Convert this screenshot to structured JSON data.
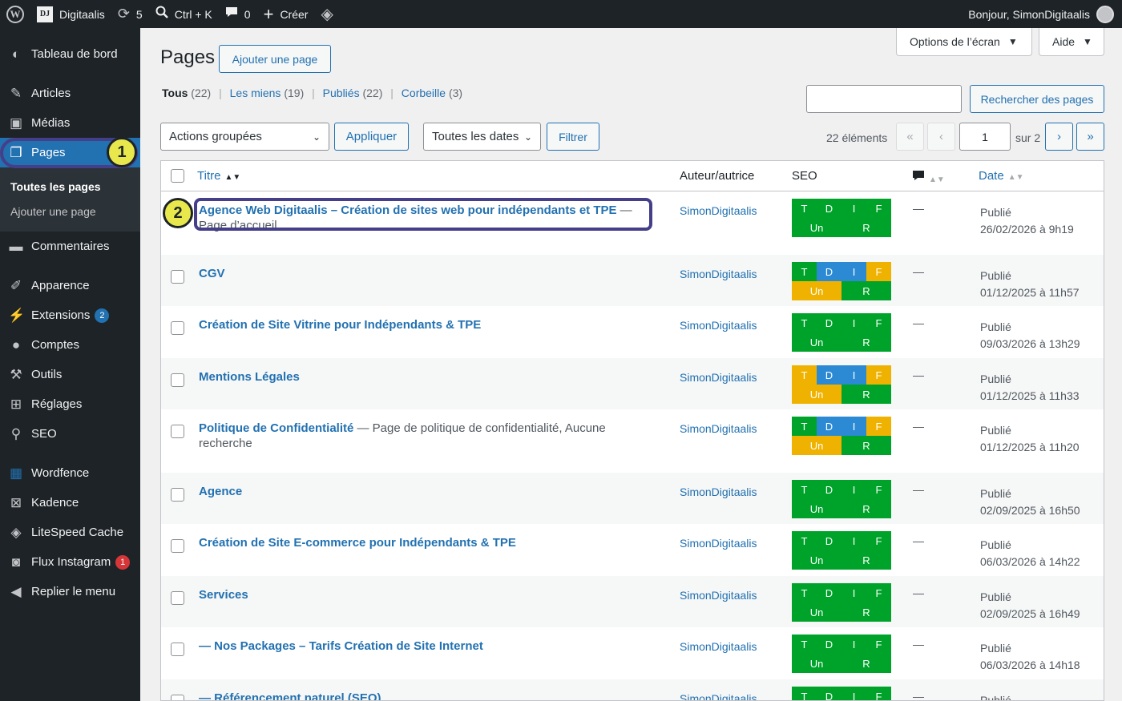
{
  "adminbar": {
    "site_name": "Digitaalis",
    "site_icon_text": "DJ",
    "updates_count": "5",
    "search_shortcut": "Ctrl + K",
    "comments_count": "0",
    "new_label": "Créer",
    "greeting": "Bonjour, SimonDigitaalis"
  },
  "sidebar": {
    "dashboard": "Tableau de bord",
    "posts": "Articles",
    "media": "Médias",
    "pages": "Pages",
    "pages_sub": [
      "Toutes les pages",
      "Ajouter une page"
    ],
    "comments": "Commentaires",
    "appearance": "Apparence",
    "plugins": "Extensions",
    "plugins_badge": "2",
    "users": "Comptes",
    "tools": "Outils",
    "settings": "Réglages",
    "seo": "SEO",
    "wordfence": "Wordfence",
    "kadence": "Kadence",
    "litespeed": "LiteSpeed Cache",
    "instagram": "Flux Instagram",
    "instagram_badge": "1",
    "collapse": "Replier le menu"
  },
  "markers": {
    "one": "1",
    "two": "2"
  },
  "header": {
    "screen_options": "Options de l’écran",
    "help": "Aide",
    "title": "Pages",
    "add_new": "Ajouter une page"
  },
  "views": {
    "all_label": "Tous",
    "all_count": "(22)",
    "mine_label": "Les miens",
    "mine_count": "(19)",
    "published_label": "Publiés",
    "published_count": "(22)",
    "trash_label": "Corbeille",
    "trash_count": "(3)"
  },
  "search": {
    "button": "Rechercher des pages",
    "value": ""
  },
  "bulk": {
    "actions": "Actions groupées",
    "apply": "Appliquer",
    "dates": "Toutes les dates",
    "filter": "Filtrer"
  },
  "pagination": {
    "items": "22 éléments",
    "first": "«",
    "prev": "‹",
    "current": "1",
    "of": "sur 2",
    "next": "›",
    "last": "»"
  },
  "table": {
    "columns": {
      "title": "Titre",
      "author": "Auteur/autrice",
      "seo": "SEO",
      "date": "Date"
    },
    "seo_labels": [
      "T",
      "D",
      "I",
      "F",
      "Un",
      "R"
    ],
    "rows": [
      {
        "title": "Agence Web Digitaalis – Création de sites web pour indépendants et TPE",
        "state": " — Page d’accueil",
        "author": "SimonDigitaalis",
        "comments": "—",
        "status": "Publié",
        "date": "26/02/2026 à 9h19",
        "seo": [
          "green",
          "green",
          "green",
          "green",
          "green",
          "green"
        ]
      },
      {
        "title": "CGV",
        "state": "",
        "author": "SimonDigitaalis",
        "comments": "—",
        "status": "Publié",
        "date": "01/12/2025 à 11h57",
        "seo": [
          "green",
          "blue",
          "blue",
          "orange",
          "orange",
          "green"
        ]
      },
      {
        "title": "Création de Site Vitrine pour Indépendants & TPE",
        "state": "",
        "author": "SimonDigitaalis",
        "comments": "—",
        "status": "Publié",
        "date": "09/03/2026 à 13h29",
        "seo": [
          "green",
          "green",
          "green",
          "green",
          "green",
          "green"
        ]
      },
      {
        "title": "Mentions Légales",
        "state": "",
        "author": "SimonDigitaalis",
        "comments": "—",
        "status": "Publié",
        "date": "01/12/2025 à 11h33",
        "seo": [
          "orange",
          "blue",
          "blue",
          "orange",
          "orange",
          "green"
        ]
      },
      {
        "title": "Politique de Confidentialité",
        "state": " — Page de politique de confidentialité, Aucune recherche",
        "author": "SimonDigitaalis",
        "comments": "—",
        "status": "Publié",
        "date": "01/12/2025 à 11h20",
        "seo": [
          "green",
          "blue",
          "blue",
          "orange",
          "orange",
          "green"
        ]
      },
      {
        "title": "Agence",
        "state": "",
        "author": "SimonDigitaalis",
        "comments": "—",
        "status": "Publié",
        "date": "02/09/2025 à 16h50",
        "seo": [
          "green",
          "green",
          "green",
          "green",
          "green",
          "green"
        ]
      },
      {
        "title": "Création de Site E-commerce pour Indépendants & TPE",
        "state": "",
        "author": "SimonDigitaalis",
        "comments": "—",
        "status": "Publié",
        "date": "06/03/2026 à 14h22",
        "seo": [
          "green",
          "green",
          "green",
          "green",
          "green",
          "green"
        ]
      },
      {
        "title": "Services",
        "state": "",
        "author": "SimonDigitaalis",
        "comments": "—",
        "status": "Publié",
        "date": "02/09/2025 à 16h49",
        "seo": [
          "green",
          "green",
          "green",
          "green",
          "green",
          "green"
        ]
      },
      {
        "title": "— Nos Packages – Tarifs Création de Site Internet",
        "state": "",
        "author": "SimonDigitaalis",
        "comments": "—",
        "status": "Publié",
        "date": "06/03/2026 à 14h18",
        "seo": [
          "green",
          "green",
          "green",
          "green",
          "green",
          "green"
        ]
      },
      {
        "title": "— Référencement naturel (SEO)",
        "state": "",
        "author": "SimonDigitaalis",
        "comments": "—",
        "status": "Publié",
        "date": "",
        "seo": [
          "green",
          "green",
          "green",
          "green",
          "green",
          "green"
        ]
      }
    ]
  },
  "colors": {
    "accent": "#2271b1",
    "admin_dark": "#1d2327",
    "seo_green": "#00a32a",
    "seo_blue": "#2b8ad3",
    "seo_orange": "#f0b200",
    "marker_yellow": "#e8e84c"
  }
}
